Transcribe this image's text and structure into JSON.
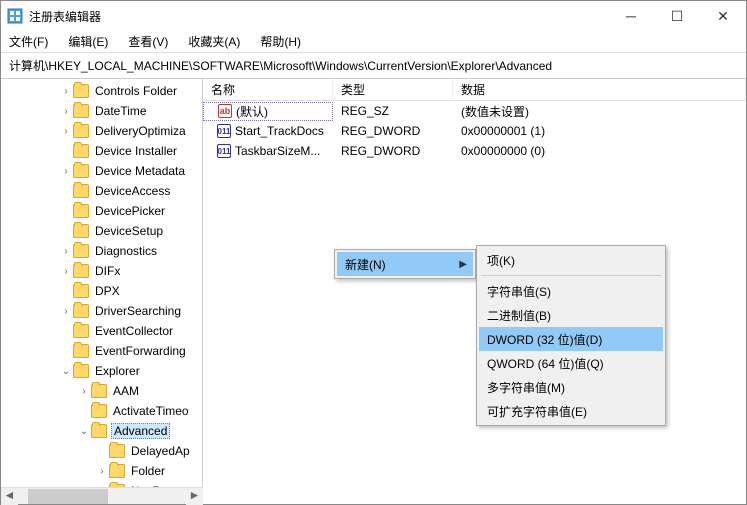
{
  "window": {
    "title": "注册表编辑器"
  },
  "menu": {
    "file": "文件(F)",
    "edit": "编辑(E)",
    "view": "查看(V)",
    "fav": "收藏夹(A)",
    "help": "帮助(H)"
  },
  "address": "计算机\\HKEY_LOCAL_MACHINE\\SOFTWARE\\Microsoft\\Windows\\CurrentVersion\\Explorer\\Advanced",
  "tree": [
    {
      "indent": 58,
      "caret": ">",
      "label": "Controls Folder"
    },
    {
      "indent": 58,
      "caret": ">",
      "label": "DateTime"
    },
    {
      "indent": 58,
      "caret": ">",
      "label": "DeliveryOptimiza"
    },
    {
      "indent": 58,
      "caret": "",
      "label": "Device Installer"
    },
    {
      "indent": 58,
      "caret": ">",
      "label": "Device Metadata"
    },
    {
      "indent": 58,
      "caret": "",
      "label": "DeviceAccess"
    },
    {
      "indent": 58,
      "caret": "",
      "label": "DevicePicker"
    },
    {
      "indent": 58,
      "caret": "",
      "label": "DeviceSetup"
    },
    {
      "indent": 58,
      "caret": ">",
      "label": "Diagnostics"
    },
    {
      "indent": 58,
      "caret": ">",
      "label": "DIFx"
    },
    {
      "indent": 58,
      "caret": "",
      "label": "DPX"
    },
    {
      "indent": 58,
      "caret": ">",
      "label": "DriverSearching"
    },
    {
      "indent": 58,
      "caret": "",
      "label": "EventCollector"
    },
    {
      "indent": 58,
      "caret": "",
      "label": "EventForwarding"
    },
    {
      "indent": 58,
      "caret": "v",
      "label": "Explorer"
    },
    {
      "indent": 76,
      "caret": ">",
      "label": "AAM"
    },
    {
      "indent": 76,
      "caret": "",
      "label": "ActivateTimeo"
    },
    {
      "indent": 76,
      "caret": "v",
      "label": "Advanced",
      "selected": true
    },
    {
      "indent": 94,
      "caret": "",
      "label": "DelayedAp"
    },
    {
      "indent": 94,
      "caret": ">",
      "label": "Folder"
    },
    {
      "indent": 94,
      "caret": "",
      "label": "NavPane"
    }
  ],
  "listhead": {
    "name": "名称",
    "type": "类型",
    "data": "数据"
  },
  "values": [
    {
      "icon": "ab",
      "name": "(默认)",
      "type": "REG_SZ",
      "data": "(数值未设置)",
      "sel": true
    },
    {
      "icon": "dw",
      "name": "Start_TrackDocs",
      "type": "REG_DWORD",
      "data": "0x00000001 (1)"
    },
    {
      "icon": "dw",
      "name": "TaskbarSizeM...",
      "type": "REG_DWORD",
      "data": "0x00000000 (0)"
    }
  ],
  "ctx1": {
    "new": "新建(N)"
  },
  "ctx2": {
    "key": "项(K)",
    "string": "字符串值(S)",
    "binary": "二进制值(B)",
    "dword": "DWORD (32 位)值(D)",
    "qword": "QWORD (64 位)值(Q)",
    "multi": "多字符串值(M)",
    "expand": "可扩充字符串值(E)"
  }
}
